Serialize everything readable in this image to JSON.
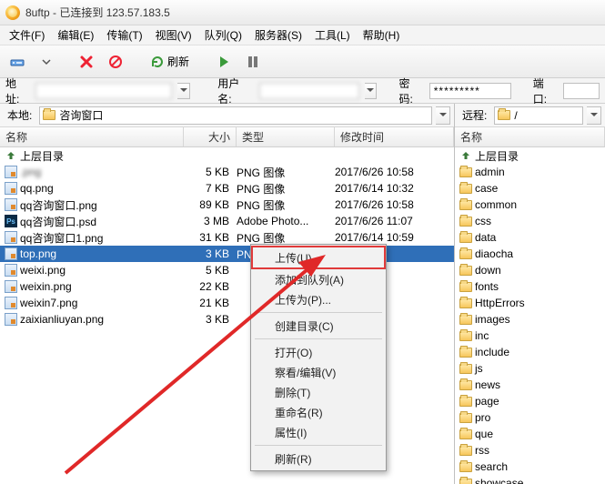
{
  "title": "8uftp - 已连接到 123.57.183.5",
  "menu": [
    "文件(F)",
    "编辑(E)",
    "传输(T)",
    "视图(V)",
    "队列(Q)",
    "服务器(S)",
    "工具(L)",
    "帮助(H)"
  ],
  "toolbar": {
    "refresh": "刷新"
  },
  "addr": {
    "addr_label": "地址:",
    "user_label": "用户名:",
    "pass_label": "密码:",
    "port_label": "端口:",
    "pass_value": "*********"
  },
  "local": {
    "label": "本地:",
    "path": "咨询窗口",
    "cols": {
      "name": "名称",
      "size": "大小",
      "type": "类型",
      "date": "修改时间"
    },
    "parent": "上层目录",
    "rows": [
      {
        "icon": "png",
        "name": "            .png",
        "size": "5 KB",
        "type": "PNG 图像",
        "date": "2017/6/26 10:58",
        "blur": true
      },
      {
        "icon": "png",
        "name": "qq.png",
        "size": "7 KB",
        "type": "PNG 图像",
        "date": "2017/6/14 10:32"
      },
      {
        "icon": "png",
        "name": "qq咨询窗口.png",
        "size": "89 KB",
        "type": "PNG 图像",
        "date": "2017/6/26 10:58"
      },
      {
        "icon": "psd",
        "name": "qq咨询窗口.psd",
        "size": "3 MB",
        "type": "Adobe Photo...",
        "date": "2017/6/26 11:07"
      },
      {
        "icon": "png",
        "name": "qq咨询窗口1.png",
        "size": "31 KB",
        "type": "PNG 图像",
        "date": "2017/6/14 10:59"
      },
      {
        "icon": "png",
        "name": "top.png",
        "size": "3 KB",
        "type": "PNG 图像",
        "date": "2017/6/14 10:34",
        "selected": true,
        "date_suffix": "4 10:34"
      },
      {
        "icon": "png",
        "name": "weixi.png",
        "size": "5 KB",
        "type": "",
        "date": "4 10:33"
      },
      {
        "icon": "png",
        "name": "weixin.png",
        "size": "22 KB",
        "type": "",
        "date": "7 17:33"
      },
      {
        "icon": "png",
        "name": "weixin7.png",
        "size": "21 KB",
        "type": "",
        "date": "7 17:33"
      },
      {
        "icon": "png",
        "name": "zaixianliuyan.png",
        "size": "3 KB",
        "type": "",
        "date": "4 10:34"
      }
    ]
  },
  "remote": {
    "label": "远程:",
    "path": "/",
    "cols": {
      "name": "名称"
    },
    "parent": "上层目录",
    "rows": [
      "admin",
      "case",
      "common",
      "css",
      "data",
      "diaocha",
      "down",
      "fonts",
      "HttpErrors",
      "images",
      "inc",
      "include",
      "js",
      "news",
      "page",
      "pro",
      "que",
      "rss",
      "search",
      "showcase"
    ]
  },
  "context_menu": {
    "items": [
      "上传(U)",
      "添加到队列(A)",
      "上传为(P)...",
      "创建目录(C)",
      "打开(O)",
      "察看/编辑(V)",
      "删除(T)",
      "重命名(R)",
      "属性(I)",
      "刷新(R)"
    ],
    "highlight_index": 0
  }
}
